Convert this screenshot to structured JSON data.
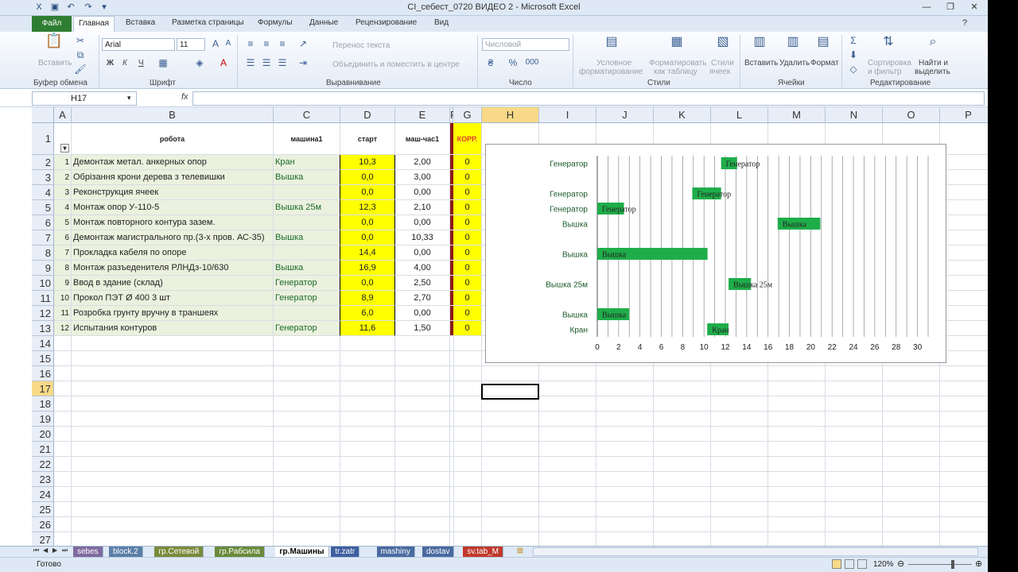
{
  "window": {
    "title": "CI_себест_0720 ВИДЕО 2  -  Microsoft Excel"
  },
  "ribbon_tabs": [
    "Файл",
    "Главная",
    "Вставка",
    "Разметка страницы",
    "Формулы",
    "Данные",
    "Рецензирование",
    "Вид"
  ],
  "ribbon": {
    "paste_label": "Вставить",
    "clipboard_group": "Буфер обмена",
    "font_name": "Arial",
    "font_size": "11",
    "font_group": "Шрифт",
    "bold": "Ж",
    "italic": "К",
    "underline": "Ч",
    "wrap_text": "Перенос текста",
    "merge_center": "Объединить и поместить в центре",
    "align_group": "Выравнивание",
    "number_format": "Числовой",
    "number_group": "Число",
    "cond_format_1": "Условное",
    "cond_format_2": "форматирование",
    "format_table_1": "Форматировать",
    "format_table_2": "как таблицу",
    "cell_styles_1": "Стили",
    "cell_styles_2": "ячеек",
    "styles_group": "Стили",
    "insert": "Вставить",
    "delete": "Удалить",
    "format": "Формат",
    "cells_group": "Ячейки",
    "sort_1": "Сортировка",
    "sort_2": "и фильтр",
    "find_1": "Найти и",
    "find_2": "выделить",
    "edit_group": "Редактирование"
  },
  "formula_bar": {
    "name_box": "H17",
    "fx": "fx",
    "formula": ""
  },
  "columns": [
    "A",
    "B",
    "C",
    "D",
    "E",
    "F",
    "G",
    "H",
    "I",
    "J",
    "K",
    "L",
    "M",
    "N",
    "O",
    "P"
  ],
  "rows": [
    "1",
    "2",
    "3",
    "4",
    "5",
    "6",
    "7",
    "8",
    "9",
    "10",
    "11",
    "12",
    "13",
    "14",
    "15",
    "16",
    "17",
    "18",
    "19",
    "20",
    "21",
    "22",
    "23",
    "24",
    "25",
    "26",
    "27"
  ],
  "table": {
    "headers": [
      "робота",
      "машина1",
      "старт",
      "маш-час1",
      "КОРР."
    ],
    "data": [
      {
        "n": "1",
        "work": "Демонтаж метал. анкерных опор",
        "machine": "Кран",
        "start": "10,3",
        "hours": "2,00",
        "corr": "0"
      },
      {
        "n": "2",
        "work": "Обрізання крони дерева з телевишки",
        "machine": "Вышка",
        "start": "0,0",
        "hours": "3,00",
        "corr": "0"
      },
      {
        "n": "3",
        "work": "Реконструкция ячеек",
        "machine": "",
        "start": "0,0",
        "hours": "0,00",
        "corr": "0"
      },
      {
        "n": "4",
        "work": "Монтаж опор У-110-5",
        "machine": "Вышка 25м",
        "start": "12,3",
        "hours": "2,10",
        "corr": "0"
      },
      {
        "n": "5",
        "work": "Монтаж повторного контура зазем.",
        "machine": "",
        "start": "0,0",
        "hours": "0,00",
        "corr": "0"
      },
      {
        "n": "6",
        "work": "Демонтаж магистрального пр.(3-х пров. АС-35)",
        "machine": "Вышка",
        "start": "0,0",
        "hours": "10,33",
        "corr": "0"
      },
      {
        "n": "7",
        "work": "Прокладка кабеля по опоре",
        "machine": "",
        "start": "14,4",
        "hours": "0,00",
        "corr": "0"
      },
      {
        "n": "8",
        "work": "Монтаж разъеденителя РЛНДз-10/630",
        "machine": "Вышка",
        "start": "16,9",
        "hours": "4,00",
        "corr": "0"
      },
      {
        "n": "9",
        "work": "Ввод в здание (склад)",
        "machine": "Генератор",
        "start": "0,0",
        "hours": "2,50",
        "corr": "0"
      },
      {
        "n": "10",
        "work": "Прокол ПЭТ Ø 400 3 шт",
        "machine": "Генератор",
        "start": "8,9",
        "hours": "2,70",
        "corr": "0"
      },
      {
        "n": "11",
        "work": "Розробка грунту вручну в траншеях",
        "machine": "",
        "start": "6,0",
        "hours": "0,00",
        "corr": "0"
      },
      {
        "n": "12",
        "work": "Испытания контуров",
        "machine": "Генератор",
        "start": "11,6",
        "hours": "1,50",
        "corr": "0"
      }
    ]
  },
  "chart_data": {
    "type": "bar",
    "orientation": "horizontal-gantt",
    "categories": [
      "Кран",
      "Вышка",
      "",
      "Вышка 25м",
      "",
      "Вышка",
      "",
      "Вышка",
      "Генератор",
      "Генератор",
      "",
      "Генератор"
    ],
    "series": [
      {
        "values": [
          10.3,
          0,
          0,
          12.3,
          0,
          0,
          14.4,
          16.9,
          0,
          8.9,
          6.0,
          11.6
        ]
      },
      {
        "values": [
          2.0,
          3.0,
          0,
          2.1,
          0,
          10.33,
          0,
          4.0,
          2.5,
          2.7,
          0,
          1.5
        ]
      }
    ],
    "bar_labels": [
      "Кран",
      "Вышка",
      "",
      "Вышка 25м",
      "",
      "Вышка",
      "",
      "Вышка",
      "Генератор",
      "Генератор",
      "",
      "Генератор"
    ],
    "xlim": [
      0,
      31
    ],
    "xticks": [
      "0",
      "2",
      "4",
      "6",
      "8",
      "10",
      "12",
      "14",
      "16",
      "18",
      "20",
      "22",
      "24",
      "26",
      "28",
      "30"
    ],
    "grid": true,
    "bar_color": "#1fad4a"
  },
  "sheet_tabs": [
    "sebes",
    "block.2",
    "гр.Сетевой",
    "гр.Рабсила",
    "гр.Машины",
    "tr.zatr",
    "mashiny",
    "dostav",
    "sv.tab_M"
  ],
  "active_sheet": "гр.Машины",
  "status": {
    "ready": "Готово",
    "zoom": "120%"
  }
}
